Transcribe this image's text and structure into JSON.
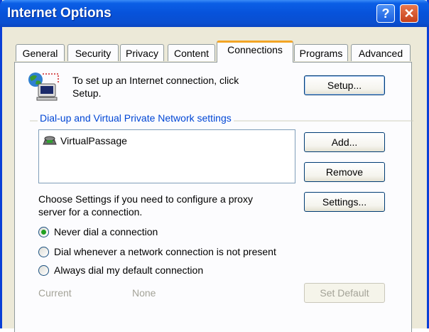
{
  "window": {
    "title": "Internet Options",
    "help_glyph": "?",
    "close_glyph": "✕"
  },
  "tabs": [
    {
      "label": "General"
    },
    {
      "label": "Security"
    },
    {
      "label": "Privacy"
    },
    {
      "label": "Content"
    },
    {
      "label": "Connections",
      "active": true
    },
    {
      "label": "Programs"
    },
    {
      "label": "Advanced"
    }
  ],
  "setup": {
    "text_line1": "To set up an Internet connection, click",
    "text_line2": "Setup.",
    "button_label": "Setup...",
    "icon": "computer-network-icon"
  },
  "dialup": {
    "group_label": "Dial-up and Virtual Private Network settings",
    "connections": [
      {
        "name": "VirtualPassage",
        "icon": "dialup-connection-icon"
      }
    ],
    "add_label": "Add...",
    "remove_label": "Remove",
    "settings_text_line1": "Choose Settings if you need to configure a proxy",
    "settings_text_line2": "server for a connection.",
    "settings_label": "Settings..."
  },
  "dial_options": [
    {
      "label": "Never dial a connection",
      "selected": true
    },
    {
      "label": "Dial whenever a network connection is not present",
      "selected": false
    },
    {
      "label": "Always dial my default connection",
      "selected": false
    }
  ],
  "default_connection": {
    "current_label": "Current",
    "current_value": "None",
    "set_default_label": "Set Default"
  },
  "colors": {
    "titlebar": "#0752da",
    "active_tab_accent": "#f3a526",
    "radio_selected": "#21a121"
  }
}
